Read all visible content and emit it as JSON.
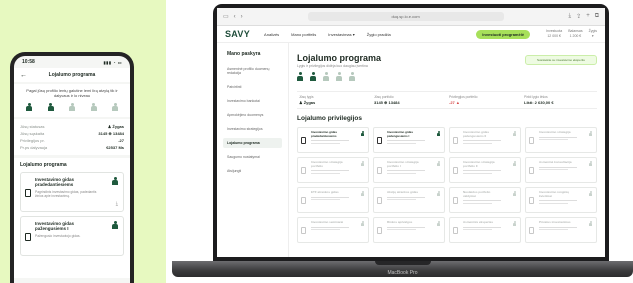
{
  "phone": {
    "time": "10:58",
    "signal": "▮▮▮ ◔ ▭",
    "header_title": "Lojalumo programa",
    "back_icon": "chevron-left-icon",
    "intro_text": "Pagal jūsų profilio lentų galutine lemi lirą atzylą tik ir dalyvaus ir lo niveau",
    "stats": [
      {
        "label": "Jūsų statusas",
        "value": "♟ Žygas"
      },
      {
        "label": "Jūsų sąskaita",
        "value": "3145 ⊕ 13484"
      },
      {
        "label": "Privilegijos pr.",
        "value": "-27"
      },
      {
        "label": "Pr.ps dalyvauja",
        "value": "€2537 Ms"
      }
    ],
    "section_title": "Lojalumo programa",
    "cards": [
      {
        "title": "Investavimo gidas pradedantiesiems",
        "sub": "Pagrindinis investavimo gidas, padedantis žinios apie investavimą."
      },
      {
        "title": "Investavimo gidas pažengusiems I",
        "sub": "Pažengusio investuotojo gidas."
      }
    ]
  },
  "laptop": {
    "url": "duq.sp.lo.e.com",
    "logo": "SAVY",
    "nav": [
      "Analizės",
      "Mano portfelis",
      "Investavimas ▾",
      "Žygio pradžia"
    ],
    "cta": "Investuoti programėlė",
    "nav_stats": [
      {
        "top": "Investuota",
        "bottom": "12 000 €"
      },
      {
        "top": "Balansas",
        "bottom": "1 200 €"
      },
      {
        "top": "Žygis",
        "bottom": "▾"
      }
    ],
    "sidebar_title": "Mano paskyra",
    "sidebar_items": [
      "Asmeninė profilio duomenų redakcija",
      "Patvirtinti",
      "Investavimo bankotai",
      "Apmokėjimo duomenys",
      "Investavimo strategijos",
      "Lojalumo programa",
      "Saugumo nustatymai",
      "Atsijungti"
    ],
    "active_index": 5,
    "main_title": "Lojalumo programa",
    "main_sub": "Lygis ir privilegijos didėja kuo daugiau įvertina",
    "notice": "Susisiekite su investavimo eksperitu",
    "stats": [
      {
        "label": "Jūsų lygis",
        "value": "♟ Žygas"
      },
      {
        "label": "Jūsų portfolio",
        "value": "3145 ⊕ 13484"
      },
      {
        "label": "Privilegijos portfelio",
        "value": "-27 ▲"
      },
      {
        "label": "Pirkti lygio lėšos",
        "value": "Likti: 2 630,00 €"
      }
    ],
    "privileges_title": "Lojalumo privilegijos",
    "cards": [
      {
        "title": "Investavimo gidas pradedantiesiems",
        "dim": false
      },
      {
        "title": "Investavimo gidas pažengusiems I",
        "dim": false
      },
      {
        "title": "Investavimo gidas pažengusiems II",
        "dim": true
      },
      {
        "title": "Investavimo strategija",
        "dim": true
      },
      {
        "title": "Investavimo strategija portfelio",
        "dim": true
      },
      {
        "title": "Investavimo strategija portfelio I",
        "dim": true
      },
      {
        "title": "Investavimo strategija portfelio II",
        "dim": true
      },
      {
        "title": "Asmeninė konsultacija",
        "dim": true
      },
      {
        "title": "ETF atrankos gidas",
        "dim": true
      },
      {
        "title": "Akcijų atrankos gidas",
        "dim": true
      },
      {
        "title": "Nuolaidos portfelio valdymui",
        "dim": true
      },
      {
        "title": "Investavimo renginių kvietimai",
        "dim": true
      },
      {
        "title": "Investavimo seminarai",
        "dim": true
      },
      {
        "title": "Rinkos apžvalgos",
        "dim": true
      },
      {
        "title": "Asmeninis ekspertas",
        "dim": true
      },
      {
        "title": "Privatus investavimas",
        "dim": true
      }
    ],
    "brand_label": "MacBook Pro"
  }
}
